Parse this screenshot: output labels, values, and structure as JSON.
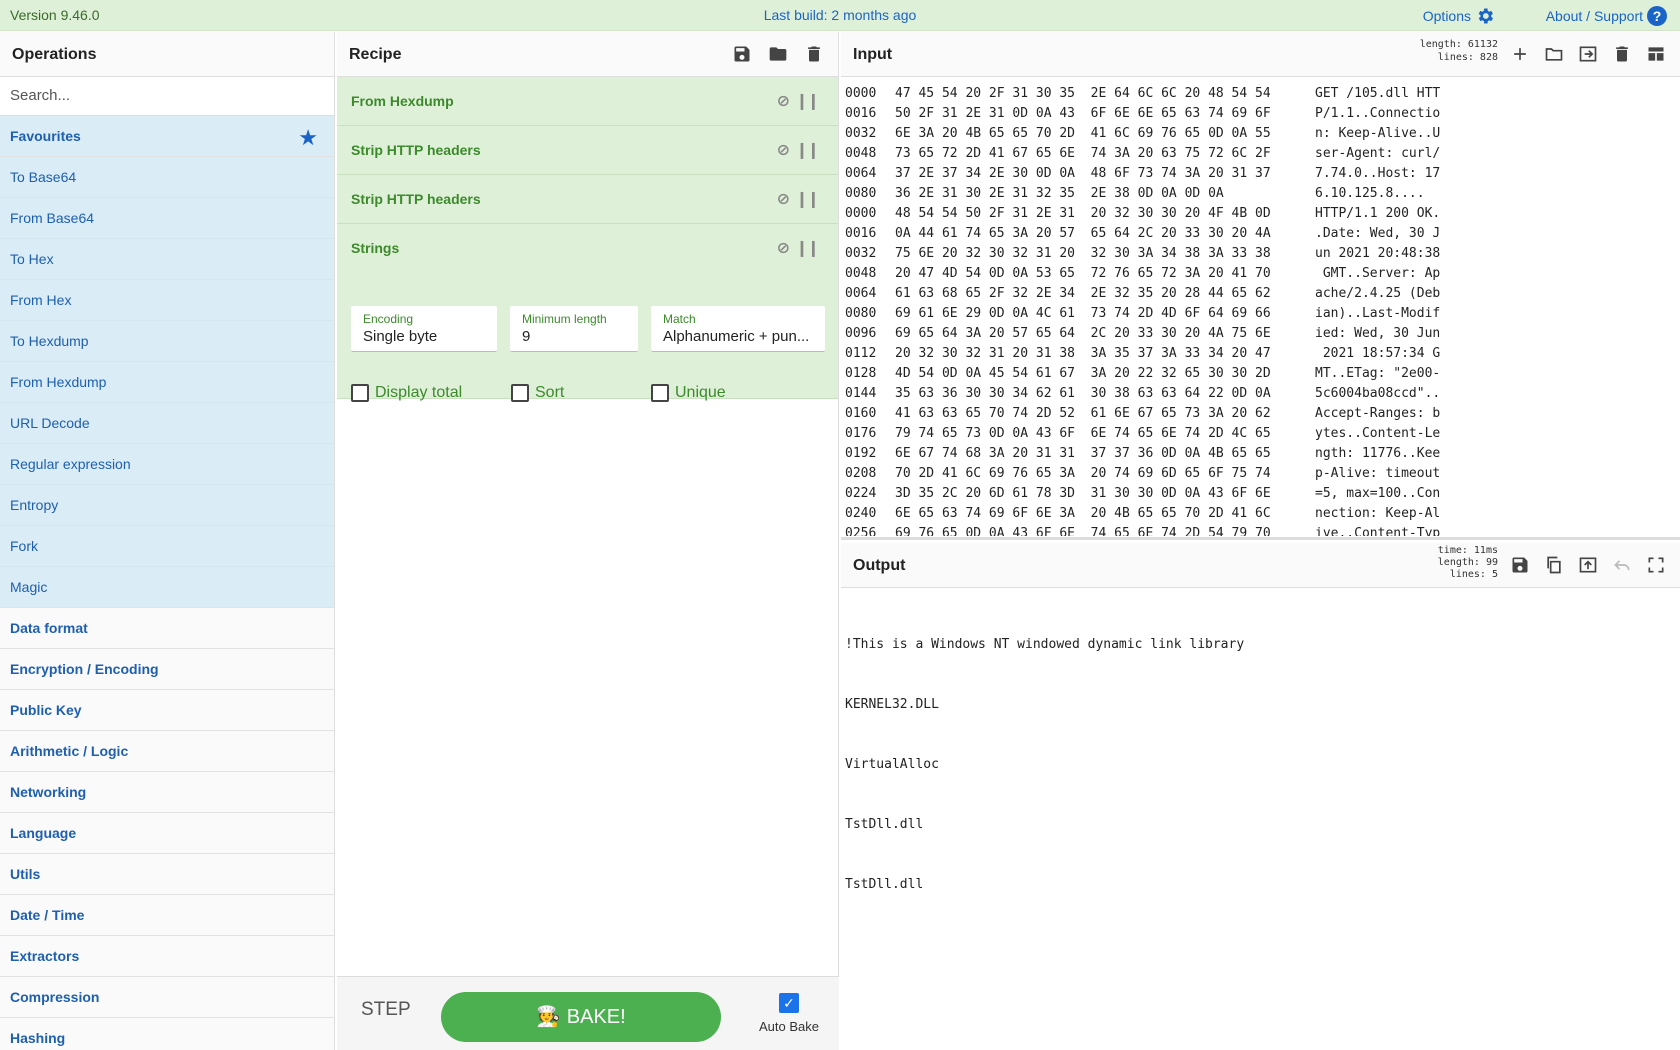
{
  "banner": {
    "version": "Version 9.46.0",
    "build": "Last build: 2 months ago",
    "options": "Options",
    "about": "About / Support"
  },
  "operations": {
    "title": "Operations",
    "search_placeholder": "Search...",
    "favourites": "Favourites",
    "items": [
      "To Base64",
      "From Base64",
      "To Hex",
      "From Hex",
      "To Hexdump",
      "From Hexdump",
      "URL Decode",
      "Regular expression",
      "Entropy",
      "Fork",
      "Magic"
    ],
    "categories": [
      "Data format",
      "Encryption / Encoding",
      "Public Key",
      "Arithmetic / Logic",
      "Networking",
      "Language",
      "Utils",
      "Date / Time",
      "Extractors",
      "Compression",
      "Hashing"
    ]
  },
  "recipe": {
    "title": "Recipe",
    "ops": [
      "From Hexdump",
      "Strip HTTP headers",
      "Strip HTTP headers",
      "Strings"
    ],
    "strings": {
      "encoding_label": "Encoding",
      "encoding_value": "Single byte",
      "minlen_label": "Minimum length",
      "minlen_value": "9",
      "match_label": "Match",
      "match_value": "Alphanumeric + pun...",
      "display_total": "Display total",
      "sort": "Sort",
      "unique": "Unique"
    },
    "step": "STEP",
    "bake": "🧑‍🍳 BAKE!",
    "auto_bake": "Auto Bake"
  },
  "input": {
    "title": "Input",
    "length": "length: 61132",
    "lines": "lines:   828",
    "rows": [
      [
        "0000",
        "47 45 54 20 2F 31 30 35  2E 64 6C 6C 20 48 54 54",
        "GET /105.dll HTT"
      ],
      [
        "0016",
        "50 2F 31 2E 31 0D 0A 43  6F 6E 6E 65 63 74 69 6F",
        "P/1.1..Connectio"
      ],
      [
        "0032",
        "6E 3A 20 4B 65 65 70 2D  41 6C 69 76 65 0D 0A 55",
        "n: Keep-Alive..U"
      ],
      [
        "0048",
        "73 65 72 2D 41 67 65 6E  74 3A 20 63 75 72 6C 2F",
        "ser-Agent: curl/"
      ],
      [
        "0064",
        "37 2E 37 34 2E 30 0D 0A  48 6F 73 74 3A 20 31 37",
        "7.74.0..Host: 17"
      ],
      [
        "0080",
        "36 2E 31 30 2E 31 32 35  2E 38 0D 0A 0D 0A",
        "6.10.125.8...."
      ],
      [
        "0000",
        "48 54 54 50 2F 31 2E 31  20 32 30 30 20 4F 4B 0D",
        "HTTP/1.1 200 OK."
      ],
      [
        "0016",
        "0A 44 61 74 65 3A 20 57  65 64 2C 20 33 30 20 4A",
        ".Date: Wed, 30 J"
      ],
      [
        "0032",
        "75 6E 20 32 30 32 31 20  32 30 3A 34 38 3A 33 38",
        "un 2021 20:48:38"
      ],
      [
        "0048",
        "20 47 4D 54 0D 0A 53 65  72 76 65 72 3A 20 41 70",
        " GMT..Server: Ap"
      ],
      [
        "0064",
        "61 63 68 65 2F 32 2E 34  2E 32 35 20 28 44 65 62",
        "ache/2.4.25 (Deb"
      ],
      [
        "0080",
        "69 61 6E 29 0D 0A 4C 61  73 74 2D 4D 6F 64 69 66",
        "ian)..Last-Modif"
      ],
      [
        "0096",
        "69 65 64 3A 20 57 65 64  2C 20 33 30 20 4A 75 6E",
        "ied: Wed, 30 Jun"
      ],
      [
        "0112",
        "20 32 30 32 31 20 31 38  3A 35 37 3A 33 34 20 47",
        " 2021 18:57:34 G"
      ],
      [
        "0128",
        "4D 54 0D 0A 45 54 61 67  3A 20 22 32 65 30 30 2D",
        "MT..ETag: \"2e00-"
      ],
      [
        "0144",
        "35 63 36 30 30 34 62 61  30 38 63 63 64 22 0D 0A",
        "5c6004ba08ccd\".."
      ],
      [
        "0160",
        "41 63 63 65 70 74 2D 52  61 6E 67 65 73 3A 20 62",
        "Accept-Ranges: b"
      ],
      [
        "0176",
        "79 74 65 73 0D 0A 43 6F  6E 74 65 6E 74 2D 4C 65",
        "ytes..Content-Le"
      ],
      [
        "0192",
        "6E 67 74 68 3A 20 31 31  37 37 36 0D 0A 4B 65 65",
        "ngth: 11776..Kee"
      ],
      [
        "0208",
        "70 2D 41 6C 69 76 65 3A  20 74 69 6D 65 6F 75 74",
        "p-Alive: timeout"
      ],
      [
        "0224",
        "3D 35 2C 20 6D 61 78 3D  31 30 30 0D 0A 43 6F 6E",
        "=5, max=100..Con"
      ],
      [
        "0240",
        "6E 65 63 74 69 6F 6E 3A  20 4B 65 65 70 2D 41 6C",
        "nection: Keep-Al"
      ],
      [
        "0256",
        "69 76 65 0D 0A 43 6F 6E  74 65 6E 74 2D 54 79 70",
        "ive..Content-Typ"
      ]
    ]
  },
  "output": {
    "title": "Output",
    "time": "time: 11ms",
    "length": "length:   99",
    "lines": "lines:    5",
    "lines_text": [
      "!This is a Windows NT windowed dynamic link library",
      "KERNEL32.DLL",
      "VirtualAlloc",
      "TstDll.dll",
      "TstDll.dll"
    ]
  }
}
